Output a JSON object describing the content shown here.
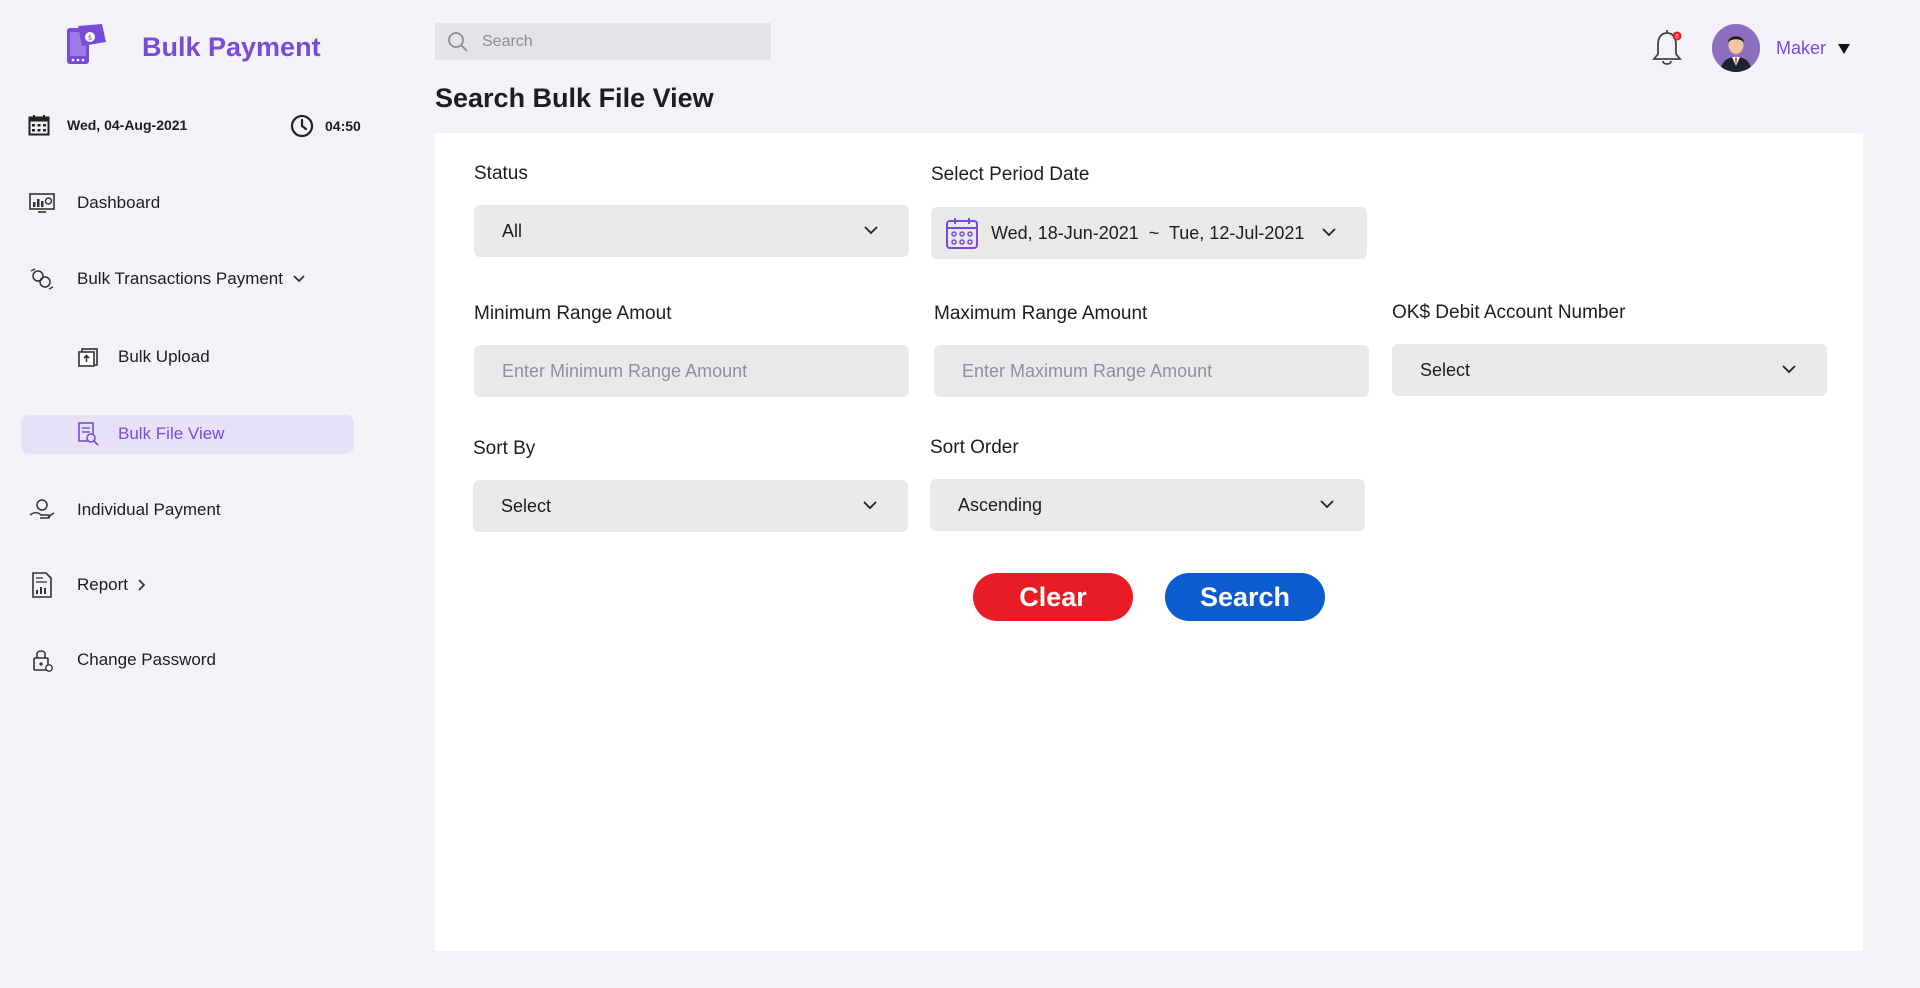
{
  "brand": {
    "name": "Bulk Payment",
    "accent": "#7a4bd8"
  },
  "datetime": {
    "date": "Wed, 04-Aug-2021",
    "time": "04:50"
  },
  "sidebar": {
    "items": [
      {
        "label": "Dashboard",
        "icon": "dashboard-icon"
      },
      {
        "label": "Bulk Transactions Payment",
        "icon": "transactions-icon"
      },
      {
        "label": "Bulk Upload",
        "icon": "upload-icon"
      },
      {
        "label": "Bulk File View",
        "icon": "file-view-icon",
        "active": true
      },
      {
        "label": "Individual Payment",
        "icon": "hand-payment-icon"
      },
      {
        "label": "Report",
        "icon": "report-icon"
      },
      {
        "label": "Change Password",
        "icon": "lock-icon"
      }
    ]
  },
  "topbar": {
    "search_placeholder": "Search",
    "notification_count": "0",
    "user_name": "Maker"
  },
  "page": {
    "title": "Search Bulk File View"
  },
  "form": {
    "status": {
      "label": "Status",
      "value": "All"
    },
    "period": {
      "label": "Select Period Date",
      "value": "Wed, 18-Jun-2021  ~  Tue, 12-Jul-2021"
    },
    "min_amount": {
      "label": "Minimum Range Amout",
      "placeholder": "Enter Minimum Range Amount"
    },
    "max_amount": {
      "label": "Maximum Range Amount",
      "placeholder": "Enter Maximum Range Amount"
    },
    "debit_account": {
      "label": "OK$ Debit Account Number",
      "value": "Select"
    },
    "sort_by": {
      "label": "Sort By",
      "value": "Select"
    },
    "sort_order": {
      "label": "Sort Order",
      "value": "Ascending"
    },
    "clear_label": "Clear",
    "search_label": "Search"
  },
  "colors": {
    "clear": "#e81c24",
    "search": "#0d5bd1",
    "active_bg": "#e6e1f7"
  }
}
